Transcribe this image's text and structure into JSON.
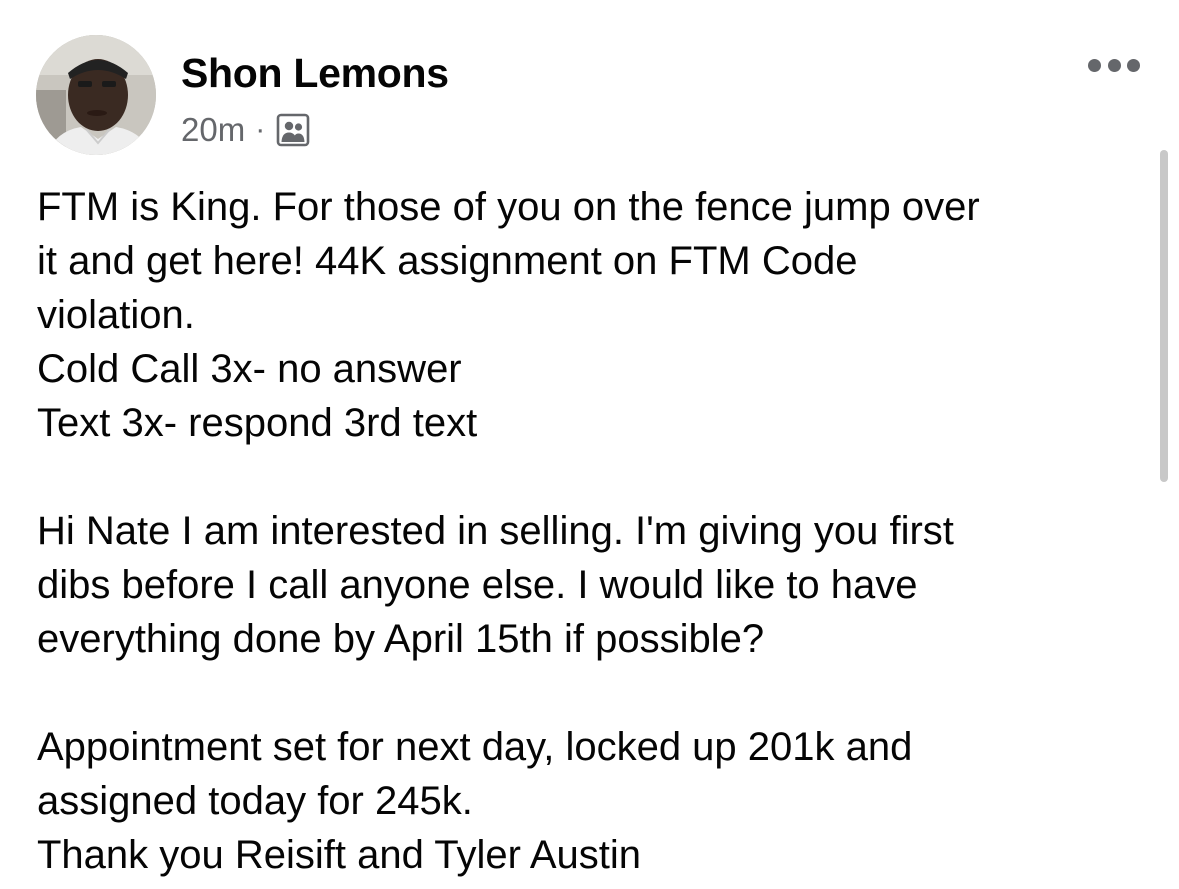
{
  "post": {
    "author": "Shon Lemons",
    "timestamp": "20m",
    "separator": "·",
    "audience_icon": "group-icon",
    "more_icon": "more-options-icon",
    "text_lines": [
      "FTM is King. For those of you on the fence jump over",
      "it and get here! 44K assignment on FTM Code",
      "violation.",
      "Cold Call 3x- no answer",
      "Text 3x- respond 3rd text",
      "",
      "Hi Nate I am interested in selling. I'm giving you first",
      "dibs before I call anyone else. I would like to have",
      "everything done by April 15th if possible?",
      "",
      "Appointment set for next day, locked up 201k and",
      "assigned today for 245k.",
      "Thank you Reisift and Tyler Austin"
    ]
  },
  "colors": {
    "text": "#050505",
    "secondary_text": "#65676b",
    "background": "#ffffff"
  }
}
